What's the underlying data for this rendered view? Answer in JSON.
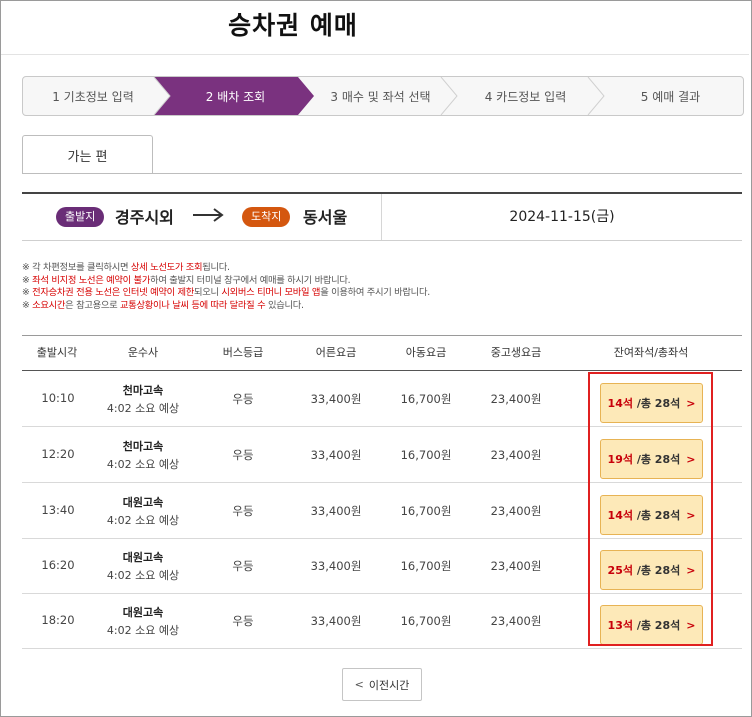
{
  "page": {
    "title": "승차권 예매"
  },
  "steps": [
    {
      "label": "1 기초정보 입력",
      "active": false
    },
    {
      "label": "2 배차 조회",
      "active": true
    },
    {
      "label": "3 매수 및 좌석 선택",
      "active": false
    },
    {
      "label": "4 카드정보 입력",
      "active": false
    },
    {
      "label": "5 예매 결과",
      "active": false
    }
  ],
  "colors": {
    "active_step": "#7a327f",
    "departure_badge": "#6a2d77",
    "arrival_badge": "#d4570f",
    "highlight_border": "#e02020",
    "seat_button_bg": "#fde9b8",
    "remaining_seats": "#c8000a"
  },
  "tab": {
    "label": "가는 편"
  },
  "route": {
    "departure_badge": "출발지",
    "departure": "경주시외",
    "arrival_badge": "도착지",
    "arrival": "동서울",
    "date": "2024-11-15(금)"
  },
  "notices": {
    "n1": {
      "a": "※ 각 차편정보를 클릭하시면 ",
      "b": "상세 노선도가 조회",
      "c": "됩니다."
    },
    "n2": {
      "a": "※ ",
      "b": "좌석 비지정 노선은 예약이 불가",
      "c": "하여 출발지 터미널 창구에서 예매를 하시기 바랍니다."
    },
    "n3": {
      "a": "※ ",
      "b": "전자승차권 전용 노선은 인터넷 예약이 제한",
      "c": "되오니 ",
      "d": "시외버스 티머니 모바일 앱",
      "e": "을 이용하여 주시기 바랍니다."
    },
    "n4": {
      "a": "※ ",
      "b": "소요시간",
      "c": "은 참고용으로 ",
      "d": "교통상황이나 날씨 등에 따라 달라질 수",
      "e": " 있습니다."
    }
  },
  "table": {
    "headers": {
      "time": "출발시각",
      "company": "운수사",
      "grade": "버스등급",
      "adult": "어른요금",
      "child": "아동요금",
      "student": "중고생요금",
      "seats": "잔여좌석/총좌석"
    },
    "rows": [
      {
        "time": "10:10",
        "company": "천마고속",
        "duration": "4:02 소요 예상",
        "grade": "우등",
        "adult": "33,400원",
        "child": "16,700원",
        "student": "23,400원",
        "remaining": "14석",
        "total": "/총 28석",
        "chevron": ">"
      },
      {
        "time": "12:20",
        "company": "천마고속",
        "duration": "4:02 소요 예상",
        "grade": "우등",
        "adult": "33,400원",
        "child": "16,700원",
        "student": "23,400원",
        "remaining": "19석",
        "total": "/총 28석",
        "chevron": ">"
      },
      {
        "time": "13:40",
        "company": "대원고속",
        "duration": "4:02 소요 예상",
        "grade": "우등",
        "adult": "33,400원",
        "child": "16,700원",
        "student": "23,400원",
        "remaining": "14석",
        "total": "/총 28석",
        "chevron": ">"
      },
      {
        "time": "16:20",
        "company": "대원고속",
        "duration": "4:02 소요 예상",
        "grade": "우등",
        "adult": "33,400원",
        "child": "16,700원",
        "student": "23,400원",
        "remaining": "25석",
        "total": "/총 28석",
        "chevron": ">"
      },
      {
        "time": "18:20",
        "company": "대원고속",
        "duration": "4:02 소요 예상",
        "grade": "우등",
        "adult": "33,400원",
        "child": "16,700원",
        "student": "23,400원",
        "remaining": "13석",
        "total": "/총 28석",
        "chevron": ">"
      }
    ]
  },
  "prev_button": {
    "chevron": "<",
    "label": "이전시간"
  }
}
